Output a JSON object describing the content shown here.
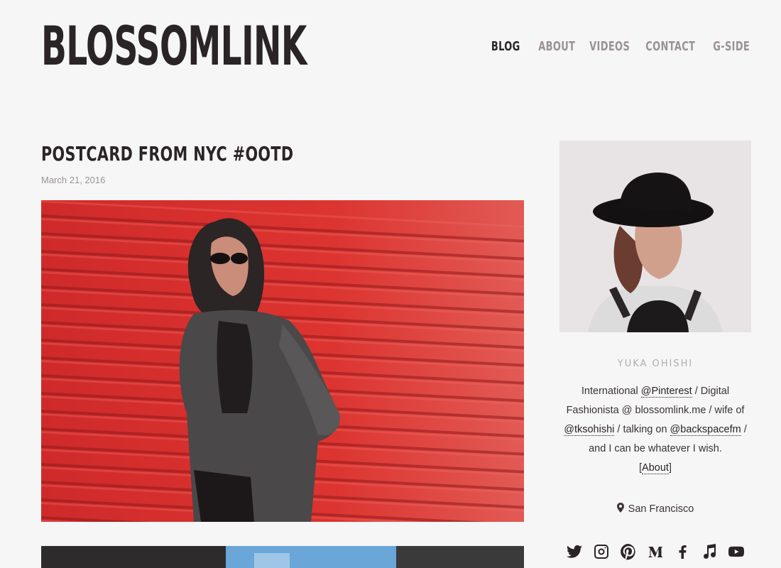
{
  "header": {
    "logo": "BLOSSOMLINK",
    "nav": [
      {
        "label": "BLOG",
        "active": true
      },
      {
        "label": "ABOUT",
        "active": false
      },
      {
        "label": "VIDEOS",
        "active": false
      },
      {
        "label": "CONTACT",
        "active": false
      },
      {
        "label": "G-SIDE",
        "active": false
      }
    ]
  },
  "post": {
    "title": "POSTCARD FROM NYC #OOTD",
    "date": "March 21, 2016"
  },
  "sidebar": {
    "author_name": "YUKA OHISHI",
    "bio": {
      "t1": "International ",
      "link_pinterest": "@Pinterest",
      "t2": " / Digital Fashionista @ blossomlink.me / wife of ",
      "link_tksohishi": "@tksohishi",
      "t3": " / talking on ",
      "link_backspacefm": "@backspacefm",
      "t4": " / and I can be whatever I wish.",
      "about_open": "[",
      "link_about": "About",
      "about_close": "]"
    },
    "location": "San Francisco",
    "social_icons": [
      "twitter-icon",
      "instagram-icon",
      "pinterest-icon",
      "medium-icon",
      "facebook-icon",
      "music-icon",
      "youtube-icon"
    ]
  },
  "colors": {
    "background": "#f6f6f6",
    "text_dark": "#2a2426",
    "nav_muted": "#9b9296",
    "photo_red": "#d8302f"
  }
}
